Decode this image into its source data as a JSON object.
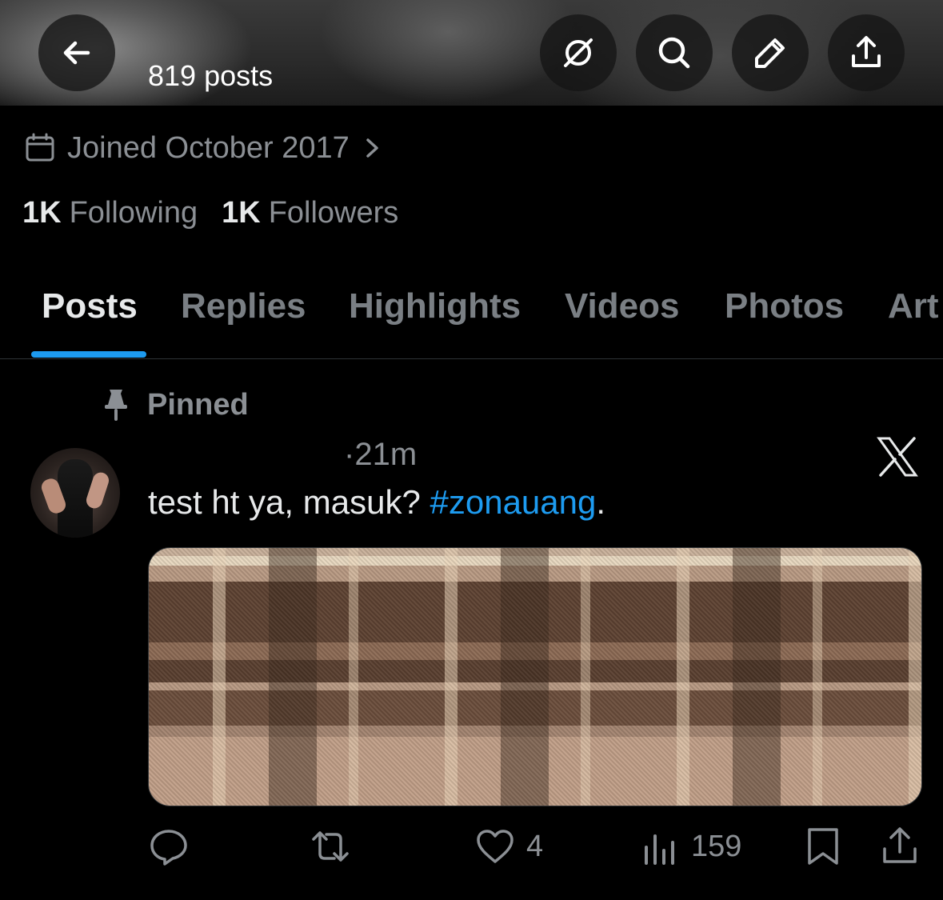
{
  "header": {
    "posts_count": "819 posts",
    "buttons": {
      "back": "arrow-left-icon",
      "grok": "grok-icon",
      "search": "search-icon",
      "edit": "pencil-icon",
      "share": "share-icon"
    }
  },
  "profile": {
    "joined": "Joined October 2017",
    "following_count": "1K",
    "following_label": "Following",
    "followers_count": "1K",
    "followers_label": "Followers"
  },
  "tabs": [
    {
      "label": "Posts",
      "active": true
    },
    {
      "label": "Replies",
      "active": false
    },
    {
      "label": "Highlights",
      "active": false
    },
    {
      "label": "Videos",
      "active": false
    },
    {
      "label": "Photos",
      "active": false
    },
    {
      "label": "Art",
      "active": false
    }
  ],
  "post": {
    "pinned_label": "Pinned",
    "timestamp": "·21m",
    "text_plain": "test ht ya, masuk? ",
    "hashtag": "#zonauang",
    "text_end": ".",
    "actions": {
      "reply_count": "",
      "repost_count": "",
      "like_count": "4",
      "views_count": "159"
    }
  },
  "colors": {
    "accent": "#1d9bf0",
    "muted_text": "#8b8f94",
    "background": "#000000"
  }
}
